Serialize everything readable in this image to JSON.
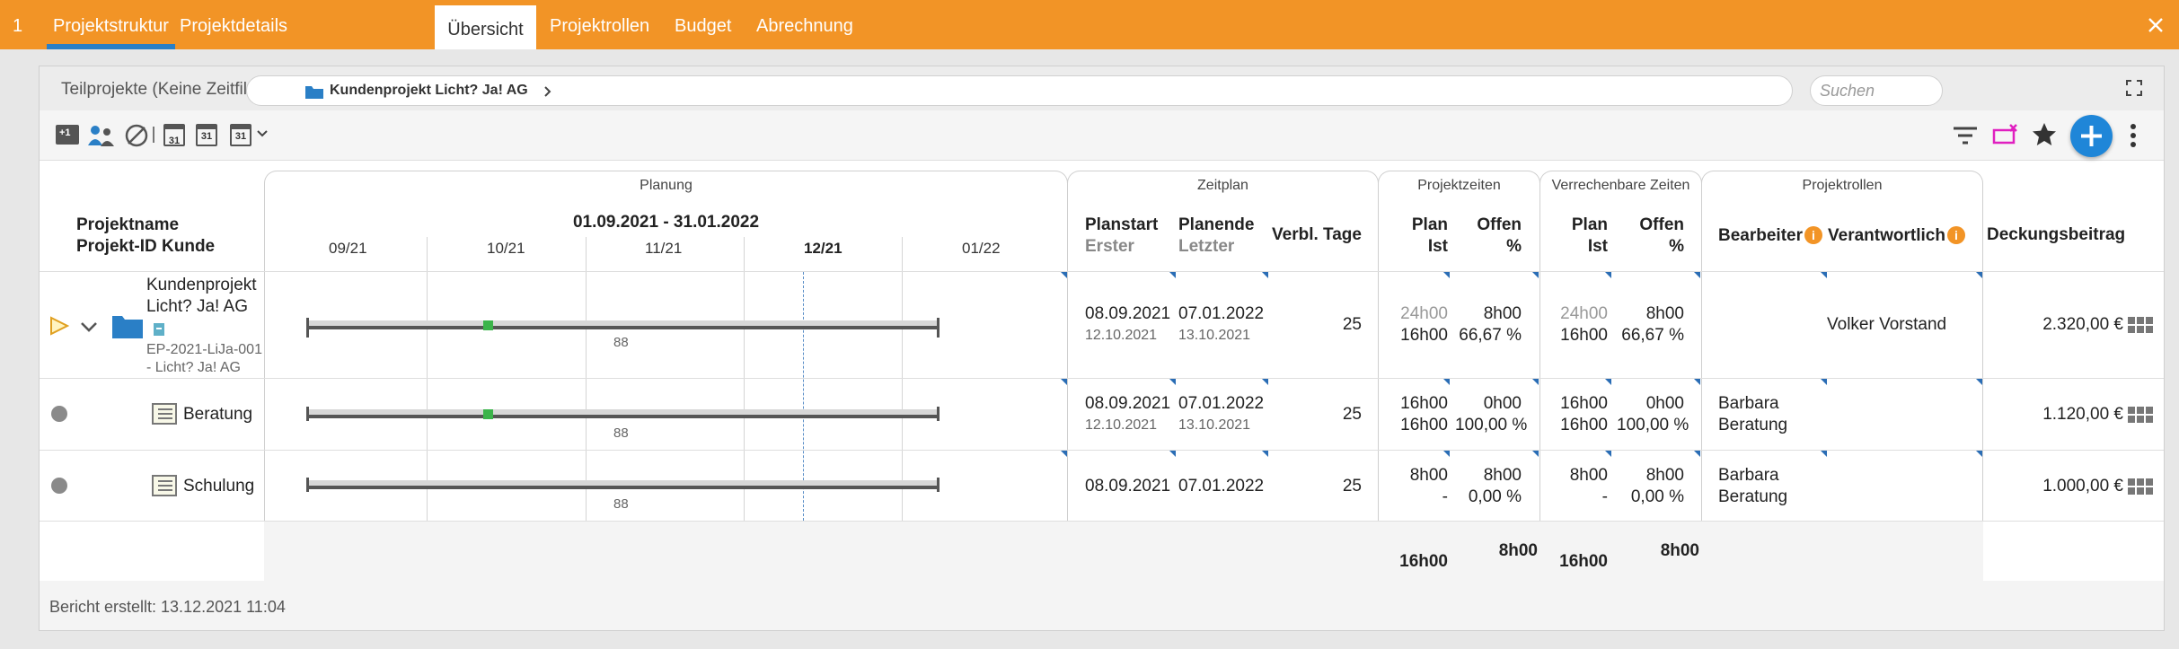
{
  "topbar": {
    "index": "1",
    "tabs": [
      "Projektstruktur",
      "Projektdetails",
      "Übersicht",
      "Projektrollen",
      "Budget",
      "Abrechnung"
    ],
    "active_tab": "Übersicht"
  },
  "panel": {
    "title": "Teilprojekte (Keine Zeitfilter)",
    "breadcrumb": "Kundenprojekt Licht? Ja! AG",
    "search_placeholder": "Suchen",
    "footer": "Bericht erstellt: 13.12.2021 11:04"
  },
  "toolbar_icons": {
    "add": "+1",
    "cal1": "31",
    "cal2": "31",
    "cal3": "31"
  },
  "groups": {
    "planung": "Planung",
    "zeitplan": "Zeitplan",
    "projektzeiten": "Projektzeiten",
    "verrechenbar": "Verrechenbare Zeiten",
    "projektrollen": "Projektrollen"
  },
  "headers": {
    "name1": "Projektname",
    "name2": "Projekt-ID Kunde",
    "range": "01.09.2021 - 31.01.2022",
    "months": [
      "09/21",
      "10/21",
      "11/21",
      "12/21",
      "01/22"
    ],
    "current_month": "12/21",
    "planstart": "Planstart",
    "erster": "Erster",
    "planende": "Planende",
    "letzter": "Letzter",
    "verbl": "Verbl. Tage",
    "plan": "Plan",
    "ist": "Ist",
    "offen": "Offen",
    "pct": "%",
    "bearbeiter": "Bearbeiter",
    "verantwortlich": "Verantwortlich",
    "deckung": "Deckungsbeitrag"
  },
  "rows": [
    {
      "name": "Kundenprojekt Licht? Ja! AG",
      "name_l1": "Kundenprojekt",
      "name_l2": "Licht? Ja! AG",
      "id_l1": "EP-2021-LiJa-001",
      "id_l2": "- Licht? Ja! AG",
      "gantt_label": "88",
      "planstart": "08.09.2021",
      "erster": "12.10.2021",
      "planende": "07.01.2022",
      "letzter": "13.10.2021",
      "verbl": "25",
      "pz_plan": "24h00",
      "pz_ist": "16h00",
      "pz_offen": "8h00",
      "pz_pct": "66,67 %",
      "vz_plan": "24h00",
      "vz_ist": "16h00",
      "vz_offen": "8h00",
      "vz_pct": "66,67 %",
      "bearbeiter_l1": "",
      "bearbeiter_l2": "",
      "verantwortlich": "Volker Vorstand",
      "deckung": "2.320,00 €"
    },
    {
      "name": "Beratung",
      "gantt_label": "88",
      "planstart": "08.09.2021",
      "erster": "12.10.2021",
      "planende": "07.01.2022",
      "letzter": "13.10.2021",
      "verbl": "25",
      "pz_plan": "16h00",
      "pz_ist": "16h00",
      "pz_offen": "0h00",
      "pz_pct": "100,00 %",
      "vz_plan": "16h00",
      "vz_ist": "16h00",
      "vz_offen": "0h00",
      "vz_pct": "100,00 %",
      "bearbeiter_l1": "Barbara",
      "bearbeiter_l2": "Beratung",
      "verantwortlich": "",
      "deckung": "1.120,00 €"
    },
    {
      "name": "Schulung",
      "gantt_label": "88",
      "planstart": "08.09.2021",
      "erster": "",
      "planende": "07.01.2022",
      "letzter": "",
      "verbl": "25",
      "pz_plan": "8h00",
      "pz_ist": "-",
      "pz_offen": "8h00",
      "pz_pct": "0,00 %",
      "vz_plan": "8h00",
      "vz_ist": "-",
      "vz_offen": "8h00",
      "vz_pct": "0,00 %",
      "bearbeiter_l1": "Barbara",
      "bearbeiter_l2": "Beratung",
      "verantwortlich": "",
      "deckung": "1.000,00 €"
    }
  ],
  "totals": {
    "pz_ist": "16h00",
    "pz_offen": "8h00",
    "vz_ist": "16h00",
    "vz_offen": "8h00"
  },
  "colors": {
    "accent": "#f29426",
    "blue": "#2a7fc6",
    "green": "#3bb44a"
  }
}
